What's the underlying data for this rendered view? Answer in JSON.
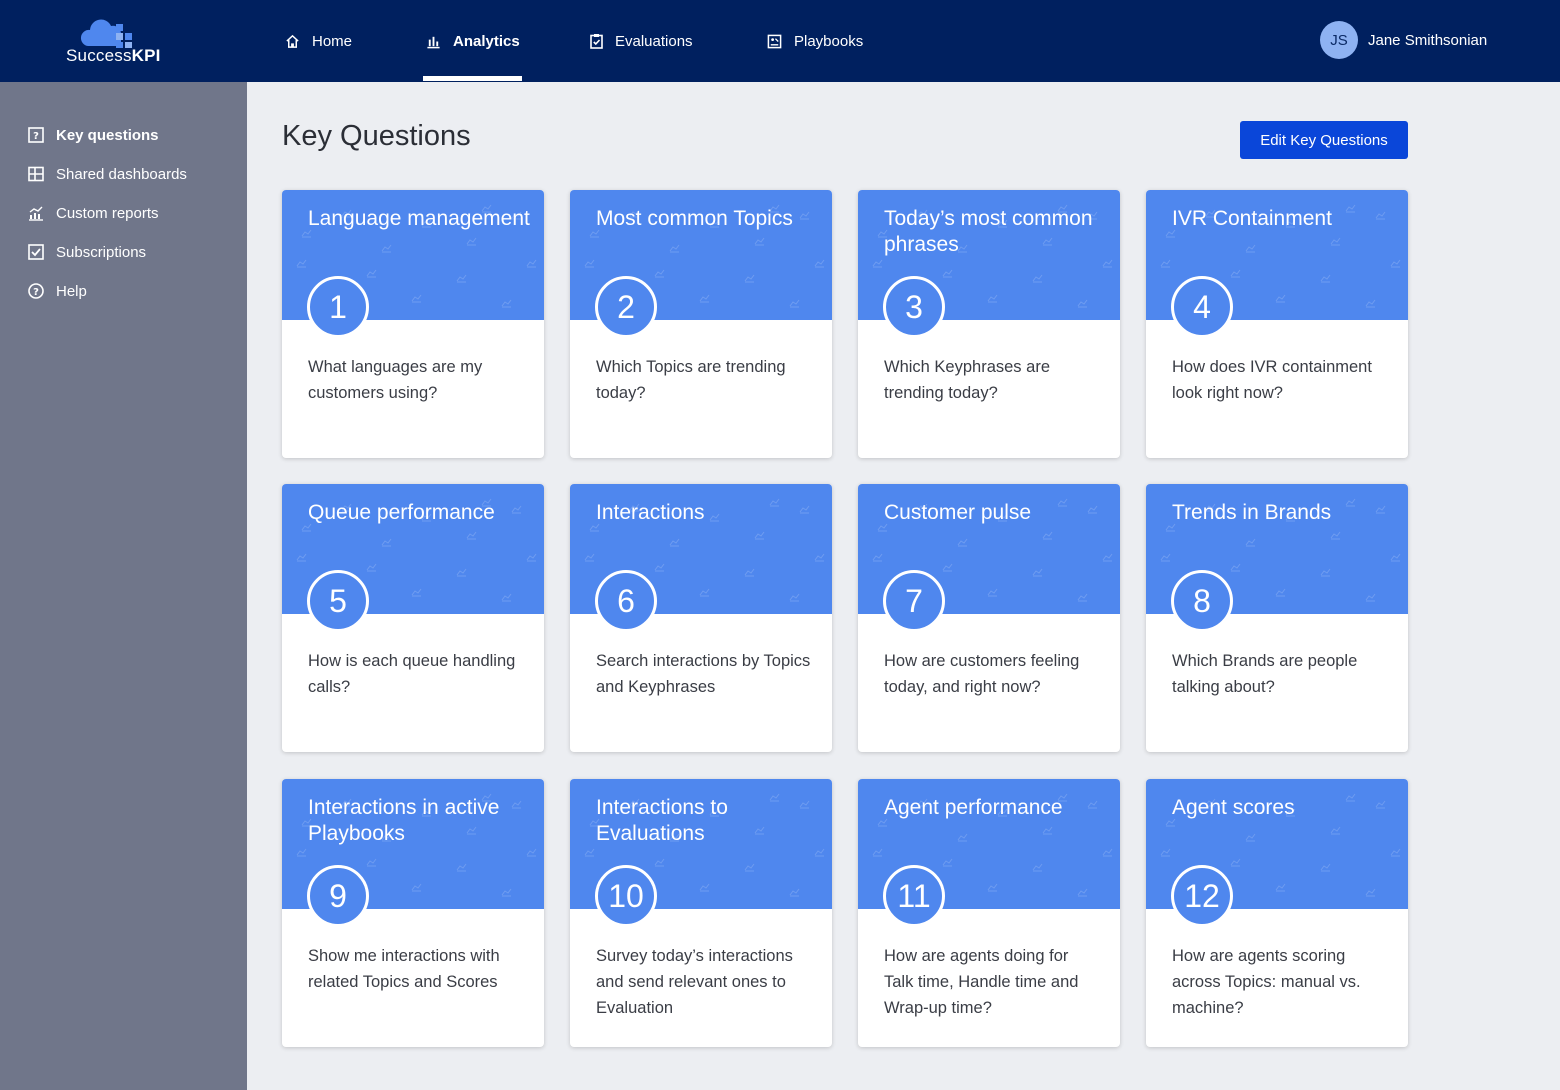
{
  "app": {
    "logo_text_light": "Success",
    "logo_text_bold": "KPI"
  },
  "nav": {
    "items": [
      {
        "label": "Home"
      },
      {
        "label": "Analytics"
      },
      {
        "label": "Evaluations"
      },
      {
        "label": "Playbooks"
      }
    ],
    "active": "Analytics"
  },
  "user": {
    "initials": "JS",
    "name": "Jane Smithsonian"
  },
  "sidebar": {
    "items": [
      {
        "label": "Key questions"
      },
      {
        "label": "Shared dashboards"
      },
      {
        "label": "Custom reports"
      },
      {
        "label": "Subscriptions"
      },
      {
        "label": "Help"
      }
    ],
    "active": "Key questions"
  },
  "main": {
    "title": "Key Questions",
    "edit_button": "Edit Key Questions",
    "cards": [
      {
        "number": "1",
        "title": "Language management",
        "question": "What languages are my customers using?"
      },
      {
        "number": "2",
        "title": "Most common Topics",
        "question": "Which Topics are trending today?"
      },
      {
        "number": "3",
        "title": "Today’s most common phrases",
        "question": "Which Keyphrases are trending today?"
      },
      {
        "number": "4",
        "title": "IVR Containment",
        "question": "How does IVR containment look right now?"
      },
      {
        "number": "5",
        "title": "Queue performance",
        "question": "How is each queue handling calls?"
      },
      {
        "number": "6",
        "title": "Interactions",
        "question": "Search interactions by Topics and Keyphrases"
      },
      {
        "number": "7",
        "title": "Customer pulse",
        "question": "How are customers feeling today, and right now?"
      },
      {
        "number": "8",
        "title": "Trends in Brands",
        "question": "Which Brands are people talking about?"
      },
      {
        "number": "9",
        "title": "Interactions in active Playbooks",
        "question": "Show me interactions with related Topics and Scores"
      },
      {
        "number": "10",
        "title": "Interactions to Evaluations",
        "question": "Survey today’s interactions and send relevant ones to Evaluation"
      },
      {
        "number": "11",
        "title": "Agent performance",
        "question": "How are agents doing for Talk time, Handle time and Wrap-up time?"
      },
      {
        "number": "12",
        "title": "Agent scores",
        "question": "How are agents scoring across Topics: manual vs. machine?"
      }
    ]
  },
  "colors": {
    "topbar": "#00205f",
    "sidebar": "#70768a",
    "background": "#eceef2",
    "card_header": "#4f87ee",
    "primary_button": "#0a46d9"
  },
  "icons": {
    "logo": "cloud-logo-icon",
    "home": "home-icon",
    "analytics": "bar-chart-icon",
    "evaluations": "clipboard-check-icon",
    "playbooks": "playbook-icon",
    "key_questions": "question-box-icon",
    "shared_dashboards": "grid-icon",
    "custom_reports": "chart-icon",
    "subscriptions": "checkbox-icon",
    "help": "help-circle-icon"
  }
}
